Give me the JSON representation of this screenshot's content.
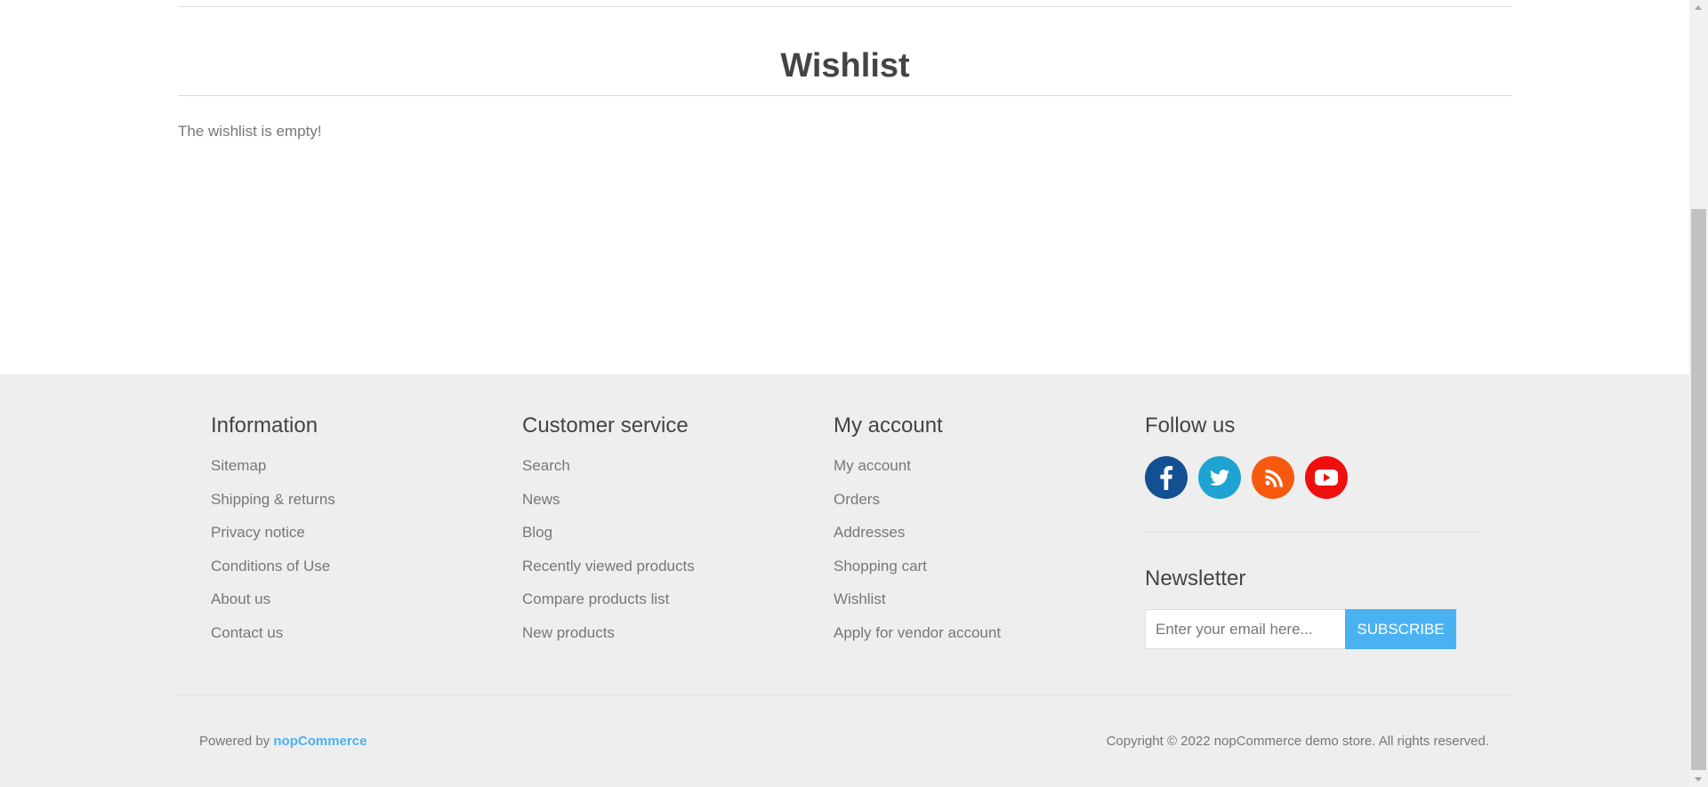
{
  "main": {
    "title": "Wishlist",
    "empty_message": "The wishlist is empty!"
  },
  "footer": {
    "information": {
      "heading": "Information",
      "items": [
        "Sitemap",
        "Shipping & returns",
        "Privacy notice",
        "Conditions of Use",
        "About us",
        "Contact us"
      ]
    },
    "customer_service": {
      "heading": "Customer service",
      "items": [
        "Search",
        "News",
        "Blog",
        "Recently viewed products",
        "Compare products list",
        "New products"
      ]
    },
    "my_account": {
      "heading": "My account",
      "items": [
        "My account",
        "Orders",
        "Addresses",
        "Shopping cart",
        "Wishlist",
        "Apply for vendor account"
      ]
    },
    "follow_us": {
      "heading": "Follow us",
      "icons": [
        "facebook-icon",
        "twitter-icon",
        "rss-icon",
        "youtube-icon"
      ],
      "icon_colors": [
        "#134f93",
        "#1ea3d2",
        "#f75a0f",
        "#ef0f0f"
      ]
    },
    "newsletter": {
      "heading": "Newsletter",
      "placeholder": "Enter your email here...",
      "button_label": "Subscribe"
    },
    "powered_by_prefix": "Powered by",
    "powered_by_link": "nopCommerce",
    "copyright": "Copyright © 2022 nopCommerce demo store. All rights reserved."
  },
  "colors": {
    "accent": "#4ab2f1",
    "footer_bg": "#eeeeee"
  }
}
